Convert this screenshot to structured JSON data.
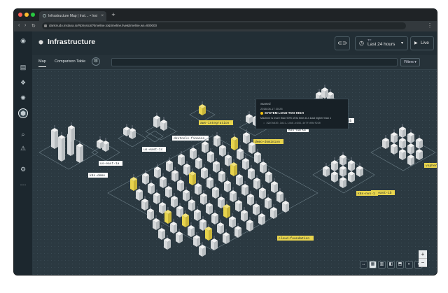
{
  "browser": {
    "tab_title": "Infrastructure Map | Inst… • Insi",
    "tab_close": "×",
    "new_tab": "+",
    "url": "danknudo.instana.io/#/physical?timeline.to&timeline.live&timeline.ws=900000",
    "menu": "⋮",
    "nav": {
      "back": "‹",
      "forward": "›",
      "reload": "↻"
    },
    "dot_colors": [
      "#ff5f57",
      "#febc2e",
      "#28c840"
    ]
  },
  "sidebar": {
    "items": [
      {
        "name": "logo-icon",
        "glyph": "◉"
      },
      {
        "name": "websites-icon",
        "glyph": "▤"
      },
      {
        "name": "applications-icon",
        "glyph": "❖"
      },
      {
        "name": "platforms-icon",
        "glyph": "✺"
      },
      {
        "name": "infrastructure-icon",
        "glyph": "⬢"
      },
      {
        "name": "analytics-icon",
        "glyph": "⌕"
      },
      {
        "name": "events-icon",
        "glyph": "⚠"
      },
      {
        "name": "settings-icon",
        "glyph": "⚙"
      },
      {
        "name": "more-icon",
        "glyph": "⋯"
      }
    ],
    "events_badge": "1"
  },
  "header": {
    "title": "Infrastructure",
    "title_icon": "⬢",
    "link_icon": "⊂⊃",
    "time_small": "TF",
    "time_label": "Last 24 hours",
    "time_chevron": "▾",
    "time_icon": "◷",
    "live_icon": "▶",
    "live_label": "Live"
  },
  "tabs": {
    "map": "Map",
    "comparison": "Comparison Table",
    "settings_icon": "⚙",
    "search_placeholder": "",
    "filters": "Filters ▾"
  },
  "map": {
    "zone_labels": [
      "k8s-demo",
      "us-east-1a",
      "us-east-1c",
      "devtools-finance",
      "aws-integration",
      "k8s-kafka",
      "demo-dominion",
      "us-east-1b",
      "gcp-36b",
      "cloud-foundation",
      "k8s-nvs-1",
      "vsphere-testenvironment"
    ],
    "highlight_color": "#e8d44d"
  },
  "tooltip": {
    "state": "Started",
    "when": "2018-06-17 20:25",
    "event": "SYSTEM LOAD TOO HIGH",
    "description": "Machine is more than 90% of its time at a load higher than 1",
    "host": "• 3997b830-3d11-14b6-b646-4e7fc00df930"
  },
  "toolbar": {
    "buttons": [
      "↔",
      "▦",
      "▥",
      "◧",
      "⬒",
      "◐",
      "◑"
    ],
    "zoom_in": "+",
    "zoom_out": "−"
  }
}
